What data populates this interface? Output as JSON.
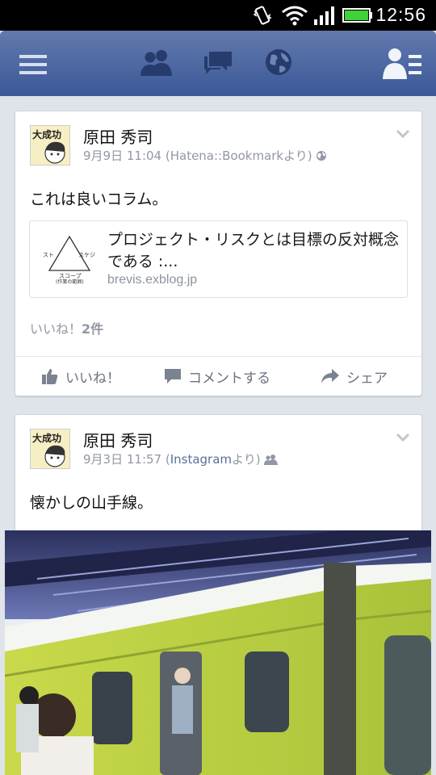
{
  "status_bar": {
    "time": "12:56"
  },
  "top_bar": {
    "icons": [
      "menu-icon",
      "friend-requests-icon",
      "messages-icon",
      "notifications-globe-icon",
      "friends-list-icon"
    ]
  },
  "posts": [
    {
      "author": "原田 秀司",
      "date": "9月9日 11:04",
      "source_prefix": " (",
      "source": "Hatena::Bookmarkより)",
      "privacy_icon": "globe-icon",
      "text": "これは良いコラム。",
      "link": {
        "title": "プロジェクト・リスクとは目標の反対概念である :...",
        "domain": "brevis.exblog.jp",
        "thumb_labels": {
          "left": "スト",
          "right": "スケジ",
          "bottom": "スコープ",
          "bottom_sub": "(作業の範囲)"
        }
      },
      "likes_prefix": "いいね！",
      "likes_count": "2件",
      "actions": {
        "like": "いいね！",
        "comment": "コメントする",
        "share": "シェア"
      }
    },
    {
      "author": "原田 秀司",
      "date": "9月3日 11:57",
      "source_open": " (",
      "source_link": "Instagram",
      "source_close": "より)",
      "privacy_icon": "friends-icon",
      "text": "懐かしの山手線。"
    }
  ],
  "avatar_text": "大成功"
}
